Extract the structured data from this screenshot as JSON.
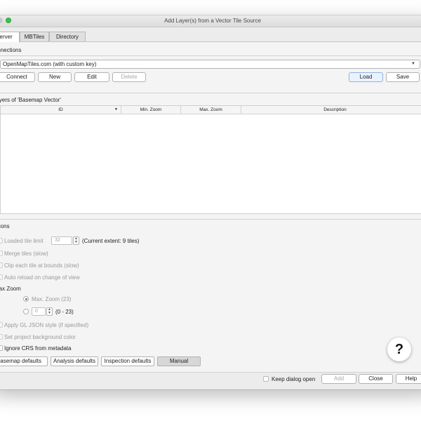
{
  "window": {
    "title": "Add Layer(s) from a Vector Tile Source"
  },
  "tabs": [
    {
      "label": "Server"
    },
    {
      "label": "MBTiles"
    },
    {
      "label": "Directory"
    }
  ],
  "connections": {
    "group_title": "Connections",
    "selected": "OpenMapTiles.com (with custom key)",
    "buttons": {
      "connect": "Connect",
      "new": "New",
      "edit": "Edit",
      "delete": "Delete",
      "load": "Load",
      "save": "Save"
    }
  },
  "layers": {
    "group_title": "Layers of 'Basemap Vector'",
    "columns": [
      "ID",
      "Min. Zoom",
      "Max. Zoom",
      "Description"
    ],
    "rows": []
  },
  "options": {
    "group_title": "Options",
    "loaded_tile_limit_label": "Loaded tile limit",
    "loaded_tile_limit_value": "32",
    "current_extent": "(Current extent: 9 tiles)",
    "merge_tiles": "Merge tiles (slow)",
    "clip_tiles": "Clip each tile at bounds (slow)",
    "auto_reload": "Auto reload on change of view",
    "max_zoom_title": "Max Zoom",
    "max_zoom_radio": "Max. Zoom (23)",
    "custom_zoom_value": "0",
    "custom_zoom_range": "(0 - 23)",
    "apply_gl_style": "Apply GL JSON style (if specified)",
    "set_background": "Set project background color",
    "ignore_crs": "Ignore CRS from metadata",
    "buttons": {
      "basemap_defaults": "Basemap defaults",
      "analysis_defaults": "Analysis defaults",
      "inspection_defaults": "Inspection defaults",
      "manual": "Manual"
    }
  },
  "help_overlay": {
    "symbol": "?"
  },
  "footer": {
    "keep_open": "Keep dialog open",
    "add": "Add",
    "close": "Close",
    "help": "Help"
  }
}
